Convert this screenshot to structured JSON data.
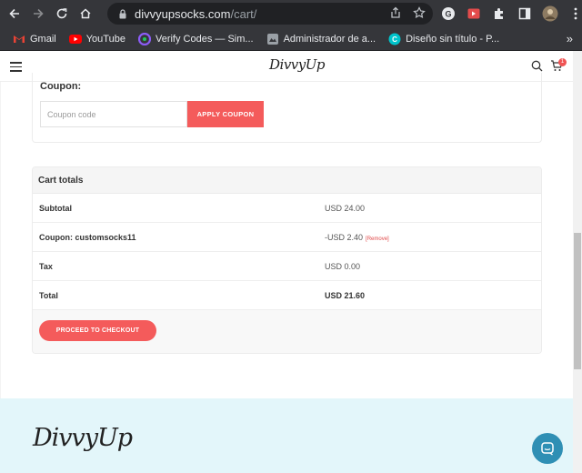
{
  "browser": {
    "url_domain": "divvyupsocks.com",
    "url_path": "/cart/",
    "bookmarks": [
      {
        "label": "Gmail",
        "icon": "gmail-icon"
      },
      {
        "label": "YouTube",
        "icon": "youtube-icon"
      },
      {
        "label": "Verify Codes — Sim...",
        "icon": "verify-icon"
      },
      {
        "label": "Administrador de a...",
        "icon": "admin-icon"
      },
      {
        "label": "Diseño sin título - P...",
        "icon": "canva-icon"
      }
    ],
    "more_bookmarks": "»"
  },
  "header": {
    "logo": "DivvyUp",
    "cart_count": "1"
  },
  "coupon": {
    "label": "Coupon:",
    "placeholder": "Coupon code",
    "apply_label": "APPLY COUPON"
  },
  "totals": {
    "heading": "Cart totals",
    "rows": [
      {
        "label": "Subtotal",
        "value": "USD 24.00"
      },
      {
        "label": "Coupon: customsocks11",
        "value": "-USD 2.40",
        "link": "[Remove]"
      },
      {
        "label": "Tax",
        "value": "USD 0.00"
      },
      {
        "label": "Total",
        "value": "USD 21.60"
      }
    ],
    "checkout_label": "PROCEED TO CHECKOUT"
  },
  "footer": {
    "logo": "DivvyUp"
  },
  "colors": {
    "accent": "#f45b5b",
    "footer_bg": "#e3f6fa",
    "chat": "#2f8fb4"
  }
}
